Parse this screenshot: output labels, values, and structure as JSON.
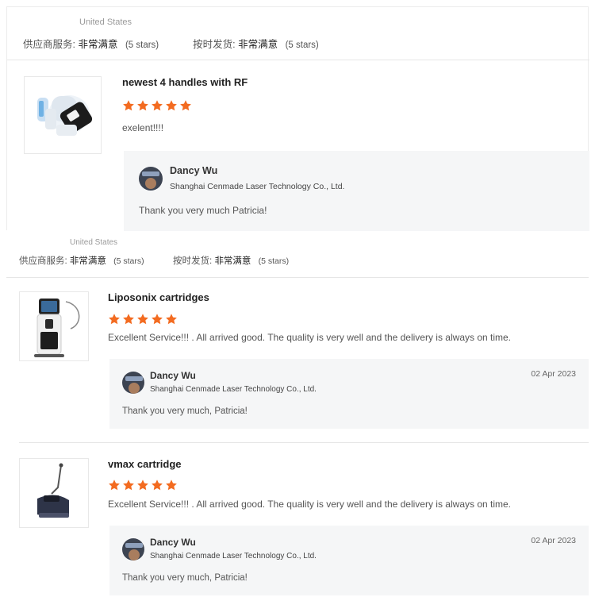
{
  "reviews_top": {
    "country": "United States",
    "ratings": {
      "supplier_label": "供应商服务:",
      "supplier_value": "非常满意",
      "supplier_stars": "(5 stars)",
      "ship_label": "按时发货:",
      "ship_value": "非常满意",
      "ship_stars": "(5 stars)"
    },
    "product": {
      "title": "newest 4 handles with RF",
      "rating": 5,
      "review": "exelent!!!!",
      "reply": {
        "name": "Dancy Wu",
        "company": "Shanghai Cenmade Laser Technology Co., Ltd.",
        "message": "Thank you very much Patricia!"
      }
    }
  },
  "reviews_bottom": {
    "country": "United States",
    "ratings": {
      "supplier_label": "供应商服务:",
      "supplier_value": "非常满意",
      "supplier_stars": "(5 stars)",
      "ship_label": "按时发货:",
      "ship_value": "非常满意",
      "ship_stars": "(5 stars)"
    },
    "items": [
      {
        "title": "Liposonix cartridges",
        "rating": 5,
        "review": "Excellent Service!!! . All arrived good. The quality is very well and the delivery is always on time.",
        "reply": {
          "name": "Dancy Wu",
          "company": "Shanghai Cenmade Laser Technology Co., Ltd.",
          "date": "02 Apr 2023",
          "message": "Thank you very much, Patricia!"
        }
      },
      {
        "title": "vmax cartridge",
        "rating": 5,
        "review": "Excellent Service!!! . All arrived good. The quality is very well and the delivery is always on time.",
        "reply": {
          "name": "Dancy Wu",
          "company": "Shanghai Cenmade Laser Technology Co., Ltd.",
          "date": "02 Apr 2023",
          "message": "Thank you very much, Patricia!"
        }
      }
    ]
  },
  "colors": {
    "star": "#f36b20",
    "reply_bg": "#f5f6f7",
    "divider": "#e6e6e6"
  },
  "icons": {
    "star": "star-icon",
    "avatar": "seller-avatar"
  }
}
